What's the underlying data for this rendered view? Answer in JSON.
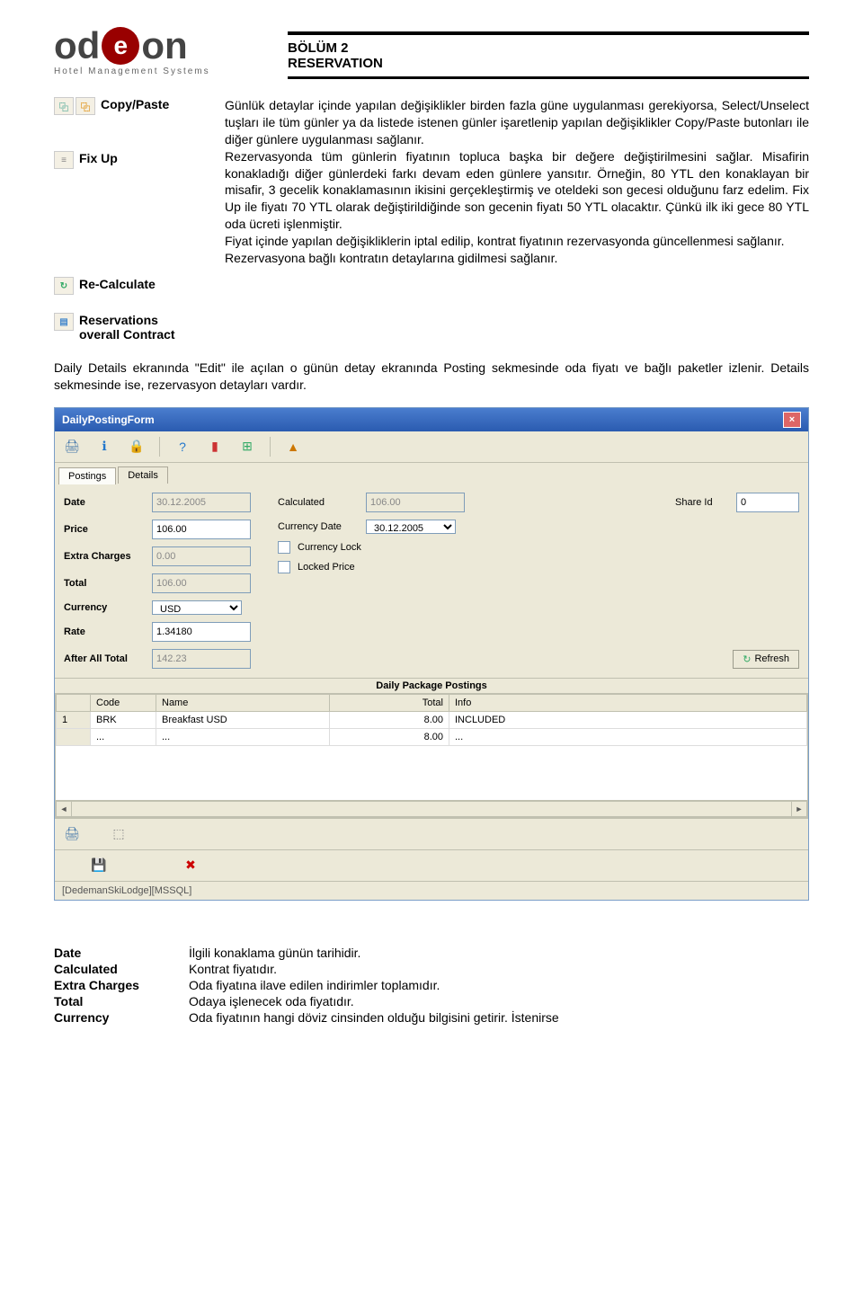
{
  "logo": {
    "part1": "od",
    "part2": "e",
    "part3": "on",
    "sub": "Hotel Management Systems"
  },
  "header": {
    "line1": "BÖLÜM 2",
    "line2": "RESERVATION"
  },
  "icon_rows": [
    {
      "label": "Copy/Paste",
      "desc": "Günlük detaylar içinde yapılan değişiklikler birden fazla güne uygulanması gerekiyorsa, Select/Unselect tuşları ile tüm günler ya da listede istenen günler işaretlenip yapılan değişiklikler Copy/Paste butonları ile diğer günlere uygulanması sağlanır."
    },
    {
      "label": "Fix Up",
      "desc": "Rezervasyonda tüm günlerin fiyatının topluca başka bir değere değiştirilmesini sağlar. Misafirin konakladığı diğer günlerdeki farkı devam eden günlere yansıtır. Örneğin, 80 YTL den konaklayan bir misafir, 3 gecelik konaklamasının ikisini gerçekleştirmiş ve oteldeki son gecesi olduğunu farz edelim. Fix Up ile fiyatı 70 YTL olarak değiştirildiğinde son gecenin fiyatı 50 YTL olacaktır. Çünkü ilk iki gece 80 YTL oda ücreti işlenmiştir."
    },
    {
      "label": "Re-Calculate",
      "desc": "Fiyat içinde yapılan değişikliklerin iptal edilip, kontrat fiyatının rezervasyonda güncellenmesi sağlanır."
    },
    {
      "label": "Reservations overall Contract",
      "desc": "Rezervasyona bağlı kontratın detaylarına gidilmesi sağlanır."
    }
  ],
  "body_para": "Daily Details ekranında \"Edit\" ile açılan o günün detay ekranında Posting sekmesinde oda fiyatı ve bağlı paketler izlenir. Details sekmesinde ise, rezervasyon detayları vardır.",
  "window": {
    "title": "DailyPostingForm",
    "tabs": {
      "postings": "Postings",
      "details": "Details"
    },
    "form": {
      "date_label": "Date",
      "date_value": "30.12.2005",
      "price_label": "Price",
      "price_value": "106.00",
      "extra_label": "Extra Charges",
      "extra_value": "0.00",
      "total_label": "Total",
      "total_value": "106.00",
      "currency_label": "Currency",
      "currency_value": "USD",
      "rate_label": "Rate",
      "rate_value": "1.34180",
      "afterall_label": "After All Total",
      "afterall_value": "142.23",
      "calculated_label": "Calculated",
      "calculated_value": "106.00",
      "currdate_label": "Currency Date",
      "currdate_value": "30.12.2005",
      "currlock_label": "Currency Lock",
      "lockprice_label": "Locked Price",
      "shareid_label": "Share Id",
      "shareid_value": "0",
      "refresh": "Refresh"
    },
    "section_title": "Daily Package Postings",
    "grid": {
      "h_idx": "",
      "h_code": "Code",
      "h_name": "Name",
      "h_total": "Total",
      "h_info": "Info",
      "r1_idx": "1",
      "r1_code": "BRK",
      "r1_name": "Breakfast USD",
      "r1_total": "8.00",
      "r1_info": "INCLUDED",
      "r2_idx": "",
      "r2_code": "...",
      "r2_name": "...",
      "r2_total": "8.00",
      "r2_info": "..."
    },
    "status": "[DedemanSkiLodge][MSSQL]"
  },
  "defs": [
    {
      "label": "Date",
      "text": "İlgili konaklama günün tarihidir."
    },
    {
      "label": "Calculated",
      "text": "Kontrat fiyatıdır."
    },
    {
      "label": "Extra Charges",
      "text": "Oda fiyatına ilave edilen indirimler toplamıdır."
    },
    {
      "label": "Total",
      "text": "Odaya işlenecek oda fiyatıdır."
    },
    {
      "label": "Currency",
      "text": "Oda fiyatının hangi döviz cinsinden olduğu bilgisini getirir. İstenirse"
    }
  ]
}
